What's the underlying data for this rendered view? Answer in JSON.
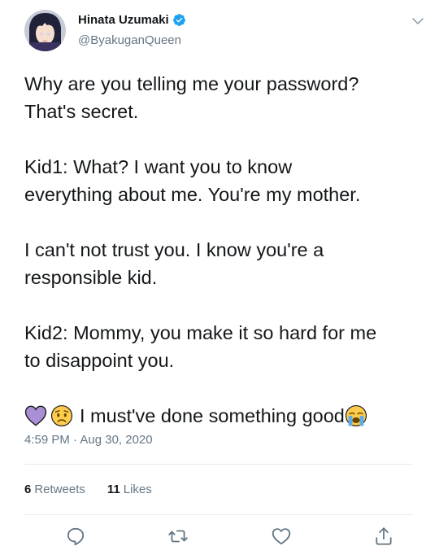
{
  "author": {
    "display_name": "Hinata Uzumaki",
    "handle": "@ByakuganQueen",
    "verified": true,
    "avatar_icon": "avatar-anime-girl"
  },
  "tweet": {
    "paragraphs": [
      "Why are you telling me your password?\nThat's secret.",
      "Kid1: What? I want you to know\neverything about me. You're my mother.",
      "I can't not trust you. I know you're a\nresponsible kid.",
      "Kid2: Mommy, you make it so hard for me\nto disappoint you."
    ],
    "last_line_text": "I must've done something good",
    "emojis": [
      "purple-heart-icon",
      "worried-face-icon",
      "loudly-crying-face-icon"
    ],
    "timestamp": "4:59 PM · Aug 30, 2020"
  },
  "stats": {
    "retweets_count": "6",
    "retweets_label": "Retweets",
    "likes_count": "11",
    "likes_label": "Likes"
  },
  "actions": [
    "reply-icon",
    "retweet-icon",
    "like-icon",
    "share-icon"
  ],
  "colors": {
    "text": "#14171a",
    "muted": "#657786",
    "accent": "#1da1f2",
    "divider": "#e6ecf0"
  }
}
